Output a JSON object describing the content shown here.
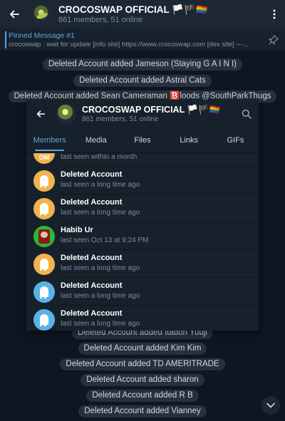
{
  "header": {
    "title": "CROCOSWAP OFFICIAL 🏳️🏴🏳️‍🌈",
    "subtitle": "861 members, 51 online",
    "back_icon": "arrow-left-icon",
    "menu_icon": "more-vertical-icon"
  },
  "pinned": {
    "label": "Pinned Message #1",
    "text": "crocoswap :  wait for update [info site]  https://www.crocoswap.com [dex site]   ---..."
  },
  "service_messages_top": [
    "Deleted Account added Jameson (Staying G A I N I)",
    "Deleted Account added Astral Cats",
    "Deleted Account added Sean Cameraman 🅱️loods @SouthParkThugs"
  ],
  "service_messages_bottom": [
    "Deleted Account added Itadori Yuuji",
    "Deleted Account added Kim Kim",
    "Deleted Account added TD AMERITRADE",
    "Deleted Account added sharon",
    "Deleted Account added R B",
    "Deleted Account added Vianney"
  ],
  "panel": {
    "title": "CROCOSWAP OFFICIAL 🏳️🏴🏳️‍🌈",
    "subtitle": "861 members, 51 online",
    "tabs": [
      {
        "label": "Members",
        "active": true
      },
      {
        "label": "Media",
        "active": false
      },
      {
        "label": "Files",
        "active": false
      },
      {
        "label": "Links",
        "active": false
      },
      {
        "label": "GIFs",
        "active": false
      }
    ],
    "members": [
      {
        "name": "",
        "seen": "last seen within a month",
        "avatar_color": "#f2b24e",
        "avatar_text": "OM"
      },
      {
        "name": "Deleted Account",
        "seen": "last seen a long time ago",
        "avatar_color": "#f2b24e"
      },
      {
        "name": "Deleted Account",
        "seen": "last seen a long time ago",
        "avatar_color": "#f2b24e"
      },
      {
        "name": "Habib Ur",
        "seen": "last seen Oct 13 at 9:24 PM",
        "avatar_color": "#2fb82f"
      },
      {
        "name": "Deleted Account",
        "seen": "last seen a long time ago",
        "avatar_color": "#f2b24e"
      },
      {
        "name": "Deleted Account",
        "seen": "last seen a long time ago",
        "avatar_color": "#5ab3e6"
      },
      {
        "name": "Deleted Account",
        "seen": "last seen a long time ago",
        "avatar_color": "#5ab3e6"
      }
    ]
  },
  "colors": {
    "background": "#0e1621",
    "panel": "#17212b",
    "accent": "#5fa5e3"
  }
}
